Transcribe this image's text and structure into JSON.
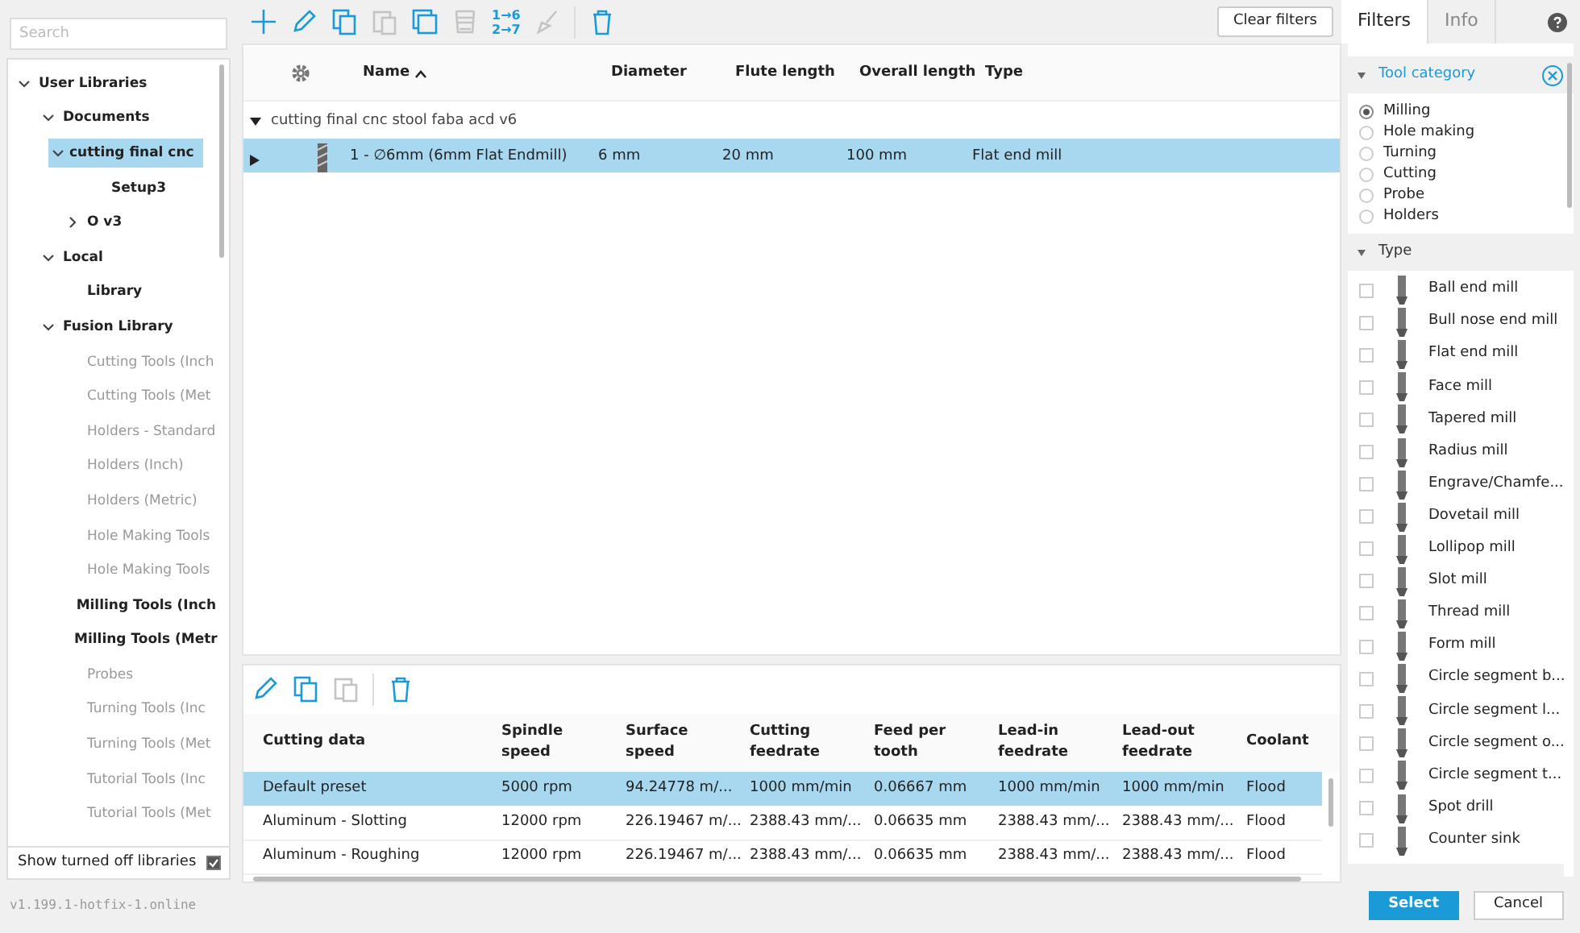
{
  "library_search": {
    "placeholder": "Search"
  },
  "tree": [
    {
      "label": "User Libraries",
      "expanded": true,
      "bold": true,
      "children": [
        {
          "label": "Documents",
          "expanded": true,
          "bold": true,
          "children": [
            {
              "label": "cutting final cnc",
              "expanded": true,
              "bold": true,
              "selected": true,
              "children": [
                {
                  "label": "Setup3",
                  "bold": true,
                  "selected": false
                }
              ]
            },
            {
              "label": "O v3",
              "expanded": false,
              "bold": true,
              "selected": false
            }
          ]
        },
        {
          "label": "Local",
          "expanded": true,
          "bold": true,
          "children": [
            {
              "label": "Library",
              "bold": true,
              "selected": false
            }
          ]
        },
        {
          "label": "Fusion Library",
          "expanded": true,
          "bold": true,
          "children": [
            {
              "label": "Cutting Tools (Inch",
              "bold": false,
              "selected": false
            },
            {
              "label": "Cutting Tools (Met",
              "bold": false,
              "selected": false
            },
            {
              "label": "Holders - Standard",
              "bold": false,
              "selected": false
            },
            {
              "label": "Holders (Inch)",
              "bold": false,
              "selected": false
            },
            {
              "label": "Holders (Metric)",
              "bold": false,
              "selected": false
            },
            {
              "label": "Hole Making Tools",
              "bold": false,
              "selected": false
            },
            {
              "label": "Hole Making Tools",
              "bold": false,
              "selected": false
            },
            {
              "label": "Milling Tools (Inch",
              "bold": true,
              "selected": false
            },
            {
              "label": "Milling Tools (Metr",
              "bold": true,
              "selected": false
            },
            {
              "label": "Probes",
              "bold": false,
              "selected": false
            },
            {
              "label": "Turning Tools (Inc",
              "bold": false,
              "selected": false
            },
            {
              "label": "Turning Tools (Met",
              "bold": false,
              "selected": false
            },
            {
              "label": "Tutorial Tools (Inc",
              "bold": false,
              "selected": false
            },
            {
              "label": "Tutorial Tools (Met",
              "bold": false,
              "selected": false
            }
          ]
        }
      ]
    }
  ],
  "show_turned_off": {
    "label": "Show turned off libraries",
    "checked": true
  },
  "version": "v1.199.1-hotfix-1.online",
  "toolbar": {
    "clear_filters": "Clear filters",
    "sequence_label": "1→6\n2→7"
  },
  "tool_table": {
    "columns": [
      "Name",
      "Diameter",
      "Flute length",
      "Overall length",
      "Type"
    ],
    "groups": [
      {
        "label": "cutting final cnc stool faba acd v6",
        "expanded": true,
        "rows": [
          {
            "cells": [
              "1 - ∅6mm (6mm Flat Endmill)",
              "6 mm",
              "20 mm",
              "100 mm",
              "Flat end mill"
            ],
            "selected": true
          }
        ]
      }
    ]
  },
  "presets": {
    "columns": [
      "Cutting data",
      "Spindle speed",
      "Surface speed",
      "Cutting feedrate",
      "Feed per tooth",
      "Lead-in feedrate",
      "Lead-out feedrate",
      "Coolant"
    ],
    "rows": [
      {
        "cells": [
          "Default preset",
          "5000 rpm",
          "94.24778 m/...",
          "1000 mm/min",
          "0.06667 mm",
          "1000 mm/min",
          "1000 mm/min",
          "Flood"
        ],
        "selected": true
      },
      {
        "cells": [
          "Aluminum - Slotting",
          "12000 rpm",
          "226.19467 m/...",
          "2388.43 mm/...",
          "0.06635 mm",
          "2388.43 mm/...",
          "2388.43 mm/...",
          "Flood"
        ],
        "selected": false
      },
      {
        "cells": [
          "Aluminum - Roughing",
          "12000 rpm",
          "226.19467 m/...",
          "2388.43 mm/...",
          "0.06635 mm",
          "2388.43 mm/...",
          "2388.43 mm/...",
          "Flood"
        ],
        "selected": false
      }
    ]
  },
  "side_tabs": [
    {
      "label": "Filters",
      "selected": true
    },
    {
      "label": "Info",
      "selected": false
    }
  ],
  "tool_category": {
    "title": "Tool category",
    "options": [
      {
        "label": "Milling",
        "selected": true
      },
      {
        "label": "Hole making",
        "selected": false
      },
      {
        "label": "Turning",
        "selected": false
      },
      {
        "label": "Cutting",
        "selected": false
      },
      {
        "label": "Probe",
        "selected": false
      },
      {
        "label": "Holders",
        "selected": false
      }
    ]
  },
  "type_filter": {
    "title": "Type",
    "options": [
      {
        "label": "Ball end mill",
        "checked": false
      },
      {
        "label": "Bull nose end mill",
        "checked": false
      },
      {
        "label": "Flat end mill",
        "checked": false
      },
      {
        "label": "Face mill",
        "checked": false
      },
      {
        "label": "Tapered mill",
        "checked": false
      },
      {
        "label": "Radius mill",
        "checked": false
      },
      {
        "label": "Engrave/Chamfe...",
        "checked": false
      },
      {
        "label": "Dovetail mill",
        "checked": false
      },
      {
        "label": "Lollipop mill",
        "checked": false
      },
      {
        "label": "Slot mill",
        "checked": false
      },
      {
        "label": "Thread mill",
        "checked": false
      },
      {
        "label": "Form mill",
        "checked": false
      },
      {
        "label": "Circle segment b...",
        "checked": false
      },
      {
        "label": "Circle segment l...",
        "checked": false
      },
      {
        "label": "Circle segment o...",
        "checked": false
      },
      {
        "label": "Circle segment t...",
        "checked": false
      },
      {
        "label": "Spot drill",
        "checked": false
      },
      {
        "label": "Counter sink",
        "checked": false
      }
    ]
  },
  "buttons": [
    "Select",
    "Cancel"
  ]
}
